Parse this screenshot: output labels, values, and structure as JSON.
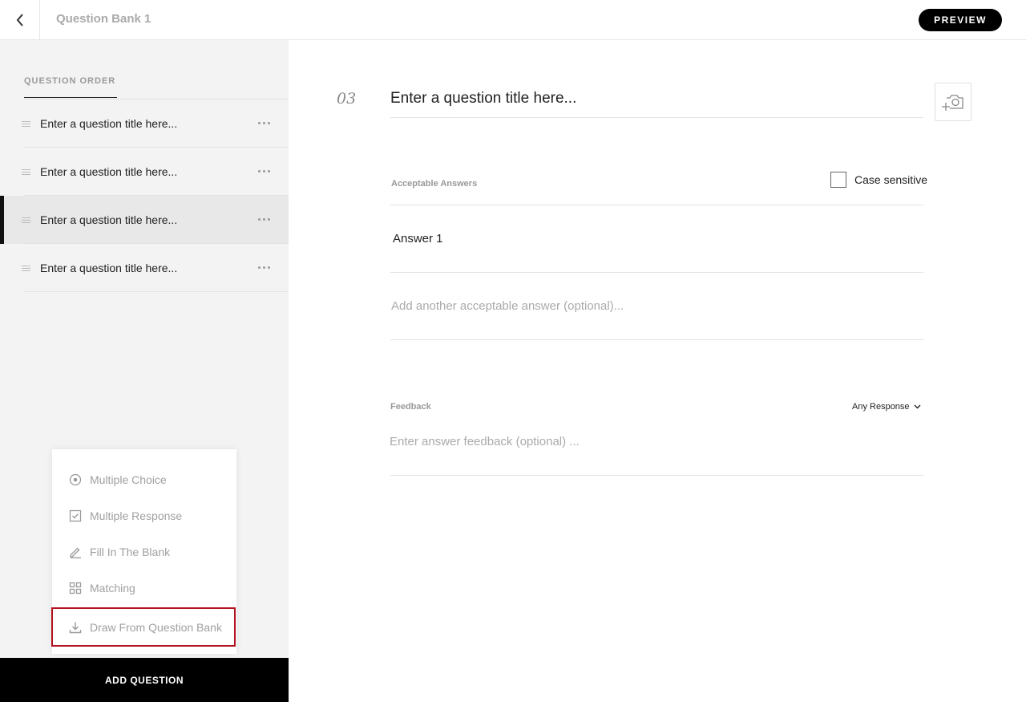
{
  "header": {
    "title": "Question Bank 1",
    "preview_label": "PREVIEW"
  },
  "sidebar": {
    "heading": "QUESTION ORDER",
    "questions": [
      {
        "label": "Enter a question title here..."
      },
      {
        "label": "Enter a question title here..."
      },
      {
        "label": "Enter a question title here...",
        "active": true
      },
      {
        "label": "Enter a question title here..."
      }
    ],
    "question_types": [
      {
        "label": "Multiple Choice",
        "icon": "radio-icon"
      },
      {
        "label": "Multiple Response",
        "icon": "checkbox-icon"
      },
      {
        "label": "Fill In The Blank",
        "icon": "pencil-icon"
      },
      {
        "label": "Matching",
        "icon": "grid-icon"
      },
      {
        "label": "Draw From Question Bank",
        "icon": "download-icon",
        "highlighted": true
      }
    ],
    "add_question_label": "ADD QUESTION"
  },
  "editor": {
    "number": "03",
    "title_placeholder": "Enter a question title here...",
    "answers_label": "Acceptable Answers",
    "case_sensitive_label": "Case sensitive",
    "case_sensitive_checked": false,
    "answers": [
      {
        "value": "Answer 1"
      }
    ],
    "add_answer_placeholder": "Add another acceptable answer (optional)...",
    "feedback_label": "Feedback",
    "response_select": "Any Response",
    "feedback_placeholder": "Enter answer feedback (optional) ..."
  },
  "colors": {
    "accent": "#000000",
    "highlight_border": "#b1121e",
    "sidebar_bg": "#f3f3f3"
  }
}
